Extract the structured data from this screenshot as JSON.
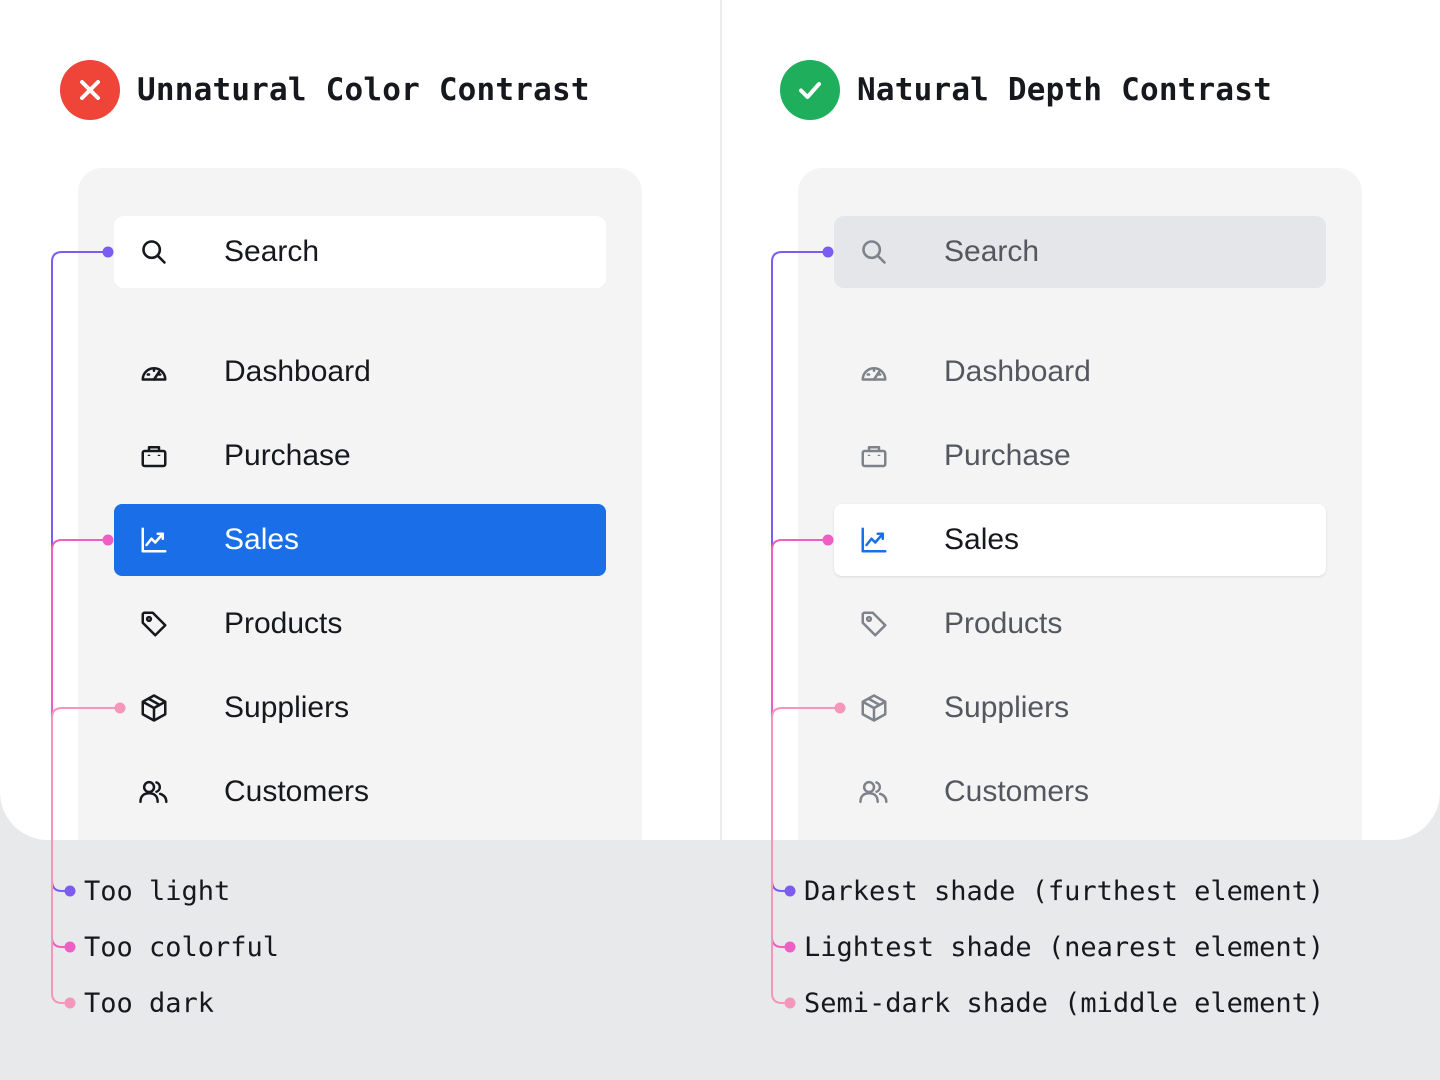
{
  "left": {
    "title": "Unnatural Color Contrast",
    "status_icon": "x-icon",
    "search": {
      "label": "Search",
      "icon": "search-icon"
    },
    "items": [
      {
        "label": "Dashboard",
        "icon": "gauge-icon",
        "active": false
      },
      {
        "label": "Purchase",
        "icon": "shopping-bag-icon",
        "active": false
      },
      {
        "label": "Sales",
        "icon": "trending-chart-icon",
        "active": true
      },
      {
        "label": "Products",
        "icon": "tag-icon",
        "active": false
      },
      {
        "label": "Suppliers",
        "icon": "package-icon",
        "active": false
      },
      {
        "label": "Customers",
        "icon": "users-icon",
        "active": false
      }
    ],
    "annotations": [
      "Too light",
      "Too colorful",
      "Too dark"
    ]
  },
  "right": {
    "title": "Natural Depth Contrast",
    "status_icon": "check-icon",
    "search": {
      "label": "Search",
      "icon": "search-icon"
    },
    "items": [
      {
        "label": "Dashboard",
        "icon": "gauge-icon",
        "active": false
      },
      {
        "label": "Purchase",
        "icon": "shopping-bag-icon",
        "active": false
      },
      {
        "label": "Sales",
        "icon": "trending-chart-icon",
        "active": true
      },
      {
        "label": "Products",
        "icon": "tag-icon",
        "active": false
      },
      {
        "label": "Suppliers",
        "icon": "package-icon",
        "active": false
      },
      {
        "label": "Customers",
        "icon": "users-icon",
        "active": false
      }
    ],
    "annotations": [
      "Darkest shade (furthest element)",
      "Lightest shade (nearest element)",
      "Semi-dark shade (middle element)"
    ]
  },
  "colors": {
    "bad": "#ef4438",
    "good": "#1fae5c",
    "accent_blue": "#1a6fe8",
    "line_purple": "#7b5cf0",
    "line_magenta": "#ee5fc6",
    "line_pink": "#f597ba",
    "panel_bg": "#f4f4f4",
    "footer_bg": "#e8e9eb"
  }
}
